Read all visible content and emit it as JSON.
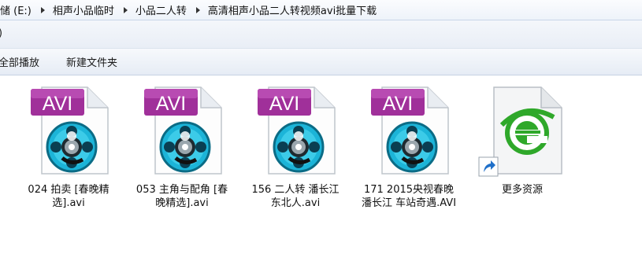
{
  "breadcrumb": {
    "items": [
      {
        "label": "储 (E:)"
      },
      {
        "label": "相声小品临时"
      },
      {
        "label": "小品二人转"
      },
      {
        "label": "高清相声小品二人转视频avi批量下载"
      }
    ]
  },
  "menu": {
    "fragment": ")"
  },
  "toolbar": {
    "play_all_label": "全部播放",
    "new_folder_label": "新建文件夹"
  },
  "files": [
    {
      "name": "024 拍卖 [春晚精选].avi",
      "badge": "AVI",
      "type": "avi-video"
    },
    {
      "name": "053 主角与配角 [春晚精选].avi",
      "badge": "AVI",
      "type": "avi-video"
    },
    {
      "name": "156 二人转 潘长江 东北人.avi",
      "badge": "AVI",
      "type": "avi-video"
    },
    {
      "name": "171 2015央视春晚 潘长江 车站奇遇.AVI",
      "badge": "AVI",
      "type": "avi-video"
    },
    {
      "name": "更多资源",
      "type": "internet-shortcut"
    }
  ],
  "colors": {
    "avi_badge": "#a0309a",
    "film_reel": "#1cb4d8",
    "ie_green": "#2fa82a",
    "shortcut_arrow": "#1f6fc9"
  }
}
